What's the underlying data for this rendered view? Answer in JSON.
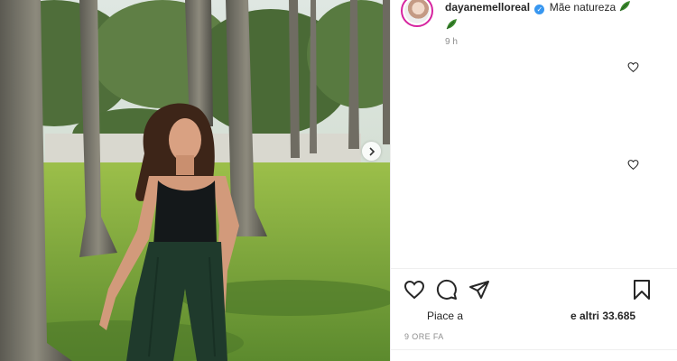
{
  "post": {
    "username": "dayanemelloreal",
    "verified_mark": "✓",
    "caption": "Mãe natureza",
    "caption_emoji": "leaf-emoji",
    "time_ago": "9 h",
    "likes_prefix": "Piace a",
    "likes_suffix": "e altri 33.685",
    "date": "9 ORE FA"
  },
  "icons": {
    "like": "heart-icon",
    "comment": "comment-bubble-icon",
    "share": "paper-plane-icon",
    "save": "bookmark-icon",
    "next": "chevron-right-icon"
  },
  "colors": {
    "verified": "#3897f0",
    "story_ring": "#d6249f",
    "muted_text": "#8e8e8e"
  }
}
